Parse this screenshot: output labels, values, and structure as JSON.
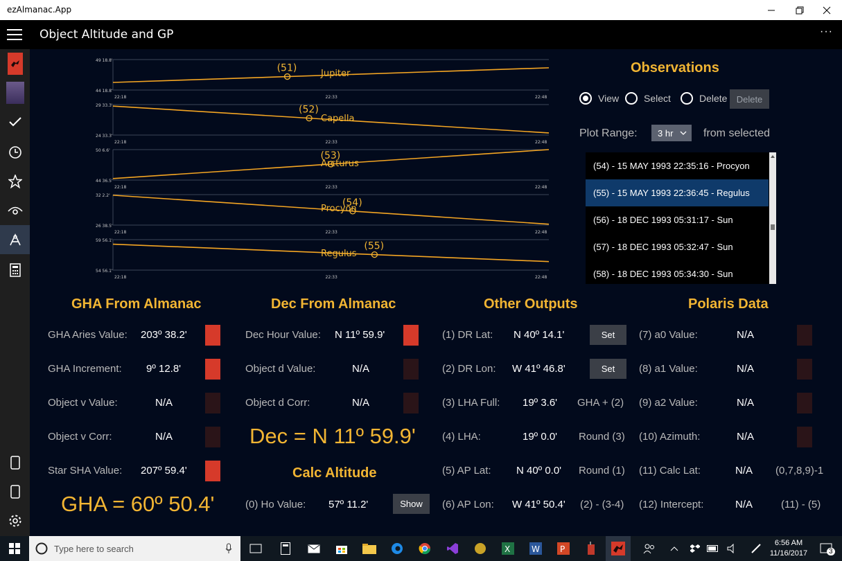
{
  "window": {
    "title": "ezAlmanac.App"
  },
  "header": {
    "title": "Object Altitude and GP"
  },
  "sidebar": {
    "items": [
      {
        "icon": "app-logo-icon"
      },
      {
        "icon": "almanac-book-icon"
      },
      {
        "icon": "checkmark-icon"
      },
      {
        "icon": "clock-icon"
      },
      {
        "icon": "star-icon"
      },
      {
        "icon": "eye-icon"
      },
      {
        "icon": "sextant-icon"
      },
      {
        "icon": "calculator-icon"
      },
      {
        "icon": "tablet-icon"
      },
      {
        "icon": "tablet-outline-icon"
      },
      {
        "icon": "settings-gear-icon"
      }
    ]
  },
  "chart_data": [
    {
      "type": "line",
      "name": "Jupiter",
      "marker": "(51)",
      "y_top": "49 18.8'",
      "y_bottom": "44 18.8'",
      "x_ticks": [
        "22:18",
        "22:33",
        "22:48"
      ],
      "y_start": 0.75,
      "y_end": 0.27,
      "marker_pos": 0.4
    },
    {
      "type": "line",
      "name": "Capella",
      "marker": "(52)",
      "y_top": "29 33.3'",
      "y_bottom": "24 33.3'",
      "x_ticks": [
        "22:18",
        "22:33",
        "22:48"
      ],
      "y_start": 0.05,
      "y_end": 0.93,
      "marker_pos": 0.45
    },
    {
      "type": "line",
      "name": "Arcturus",
      "marker": "(53)",
      "y_top": "50 6.6'",
      "y_bottom": "44 36.5'",
      "x_ticks": [
        "22:18",
        "22:33",
        "22:48"
      ],
      "y_start": 0.95,
      "y_end": 0.0,
      "marker_pos": 0.5
    },
    {
      "type": "line",
      "name": "Procyon",
      "marker": "(54)",
      "y_top": "32 2.2'",
      "y_bottom": "26 38.5'",
      "x_ticks": [
        "22:18",
        "22:33",
        "22:48"
      ],
      "y_start": 0.02,
      "y_end": 0.97,
      "marker_pos": 0.55
    },
    {
      "type": "line",
      "name": "Regulus",
      "marker": "(55)",
      "y_top": "59 56.1'",
      "y_bottom": "54 56.1'",
      "x_ticks": [
        "22:18",
        "22:33",
        "22:48"
      ],
      "y_start": 0.15,
      "y_end": 0.72,
      "marker_pos": 0.6
    }
  ],
  "observations": {
    "title": "Observations",
    "radios": {
      "view": "View",
      "select": "Select",
      "delete": "Delete"
    },
    "delete_button": "Delete",
    "plot_range_label": "Plot Range:",
    "plot_range_value": "3 hr",
    "from_selected": "from selected",
    "list": [
      "(54) - 15 MAY 1993 22:35:16 - Procyon",
      "(55) - 15 MAY 1993 22:36:45 - Regulus",
      "(56) - 18 DEC 1993 05:31:17 - Sun",
      "(57) - 18 DEC 1993 05:32:47 - Sun",
      "(58) - 18 DEC 1993 05:34:30 - Sun"
    ]
  },
  "gha": {
    "title": "GHA From Almanac",
    "rows": [
      {
        "label": "GHA Aries Value:",
        "value": "203º 38.2'"
      },
      {
        "label": "GHA Increment:",
        "value": "9º 12.8'"
      },
      {
        "label": "Object v Value:",
        "value": "N/A"
      },
      {
        "label": "Object v Corr:",
        "value": "N/A"
      },
      {
        "label": "Star SHA Value:",
        "value": "207º 59.4'"
      }
    ],
    "result": "GHA = 60º 50.4'"
  },
  "dec": {
    "title": "Dec From Almanac",
    "rows": [
      {
        "label": "Dec Hour Value:",
        "value": "N 11º 59.9'"
      },
      {
        "label": "Object d Value:",
        "value": "N/A"
      },
      {
        "label": "Object d Corr:",
        "value": "N/A"
      }
    ],
    "result": "Dec = N 11º 59.9'"
  },
  "calc_alt": {
    "title": "Calc Altitude",
    "label": "(0) Ho Value:",
    "value": "57º 11.2'",
    "button": "Show"
  },
  "other": {
    "title": "Other Outputs",
    "rows": [
      {
        "label": "(1) DR Lat:",
        "value": "N 40º 14.1'",
        "extra": "Set"
      },
      {
        "label": "(2) DR Lon:",
        "value": "W 41º 46.8'",
        "extra": "Set"
      },
      {
        "label": "(3) LHA Full:",
        "value": "19º 3.6'",
        "extra": "GHA + (2)"
      },
      {
        "label": "(4) LHA:",
        "value": "19º 0.0'",
        "extra": "Round (3)"
      },
      {
        "label": "(5) AP Lat:",
        "value": "N 40º 0.0'",
        "extra": "Round (1)"
      },
      {
        "label": "(6) AP Lon:",
        "value": "W 41º 50.4'",
        "extra": "(2) - (3-4)"
      }
    ]
  },
  "polaris": {
    "title": "Polaris Data",
    "rows": [
      {
        "label": "(7) a0 Value:",
        "value": "N/A"
      },
      {
        "label": "(8) a1 Value:",
        "value": "N/A"
      },
      {
        "label": "(9) a2 Value:",
        "value": "N/A"
      },
      {
        "label": "(10) Azimuth:",
        "value": "N/A"
      },
      {
        "label": "(11) Calc Lat:",
        "value": "N/A",
        "extra": "(0,7,8,9)-1"
      },
      {
        "label": "(12) Intercept:",
        "value": "N/A",
        "extra": "(11) - (5)"
      }
    ]
  },
  "taskbar": {
    "search_placeholder": "Type here to search",
    "time": "6:56 AM",
    "date": "11/16/2017",
    "notifications": "3"
  },
  "colors": {
    "accent": "#f2b533",
    "line": "#f5a623",
    "background": "#020a1c",
    "selected": "#0f3a6a"
  }
}
